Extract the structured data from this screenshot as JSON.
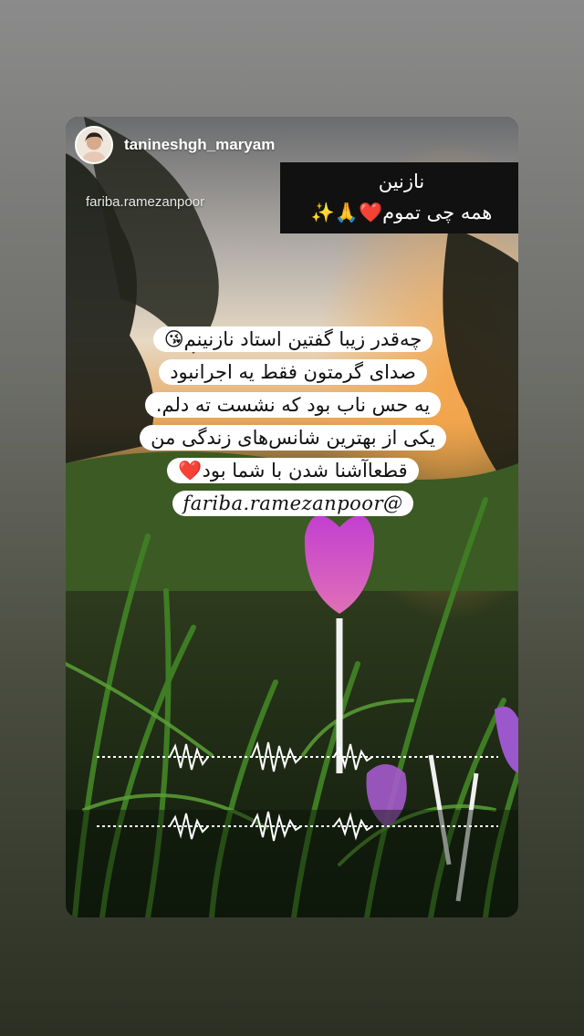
{
  "story": {
    "username": "tanineshgh_maryam",
    "mention": "fariba.ramezanpoor",
    "top_sticker": {
      "line1": "نازنین",
      "line2": "همه چی تموم❤️🙏✨"
    },
    "quote_lines": [
      "چه‌قدر زیبا گفتین استاد نازنینم😘",
      "صدای گرمتون فقط یه اجرانبود",
      "یه حس ناب بود که نشست ته دلم.",
      "یکی از بهترین شانس‌های زندگی من",
      "قطعاآشنا شدن با شما بود❤️",
      "fariba.ramezanpoor@"
    ]
  },
  "colors": {
    "sticker_bg": "#111111",
    "quote_bg": "#ffffff",
    "accent_heart": "#e0182d"
  }
}
